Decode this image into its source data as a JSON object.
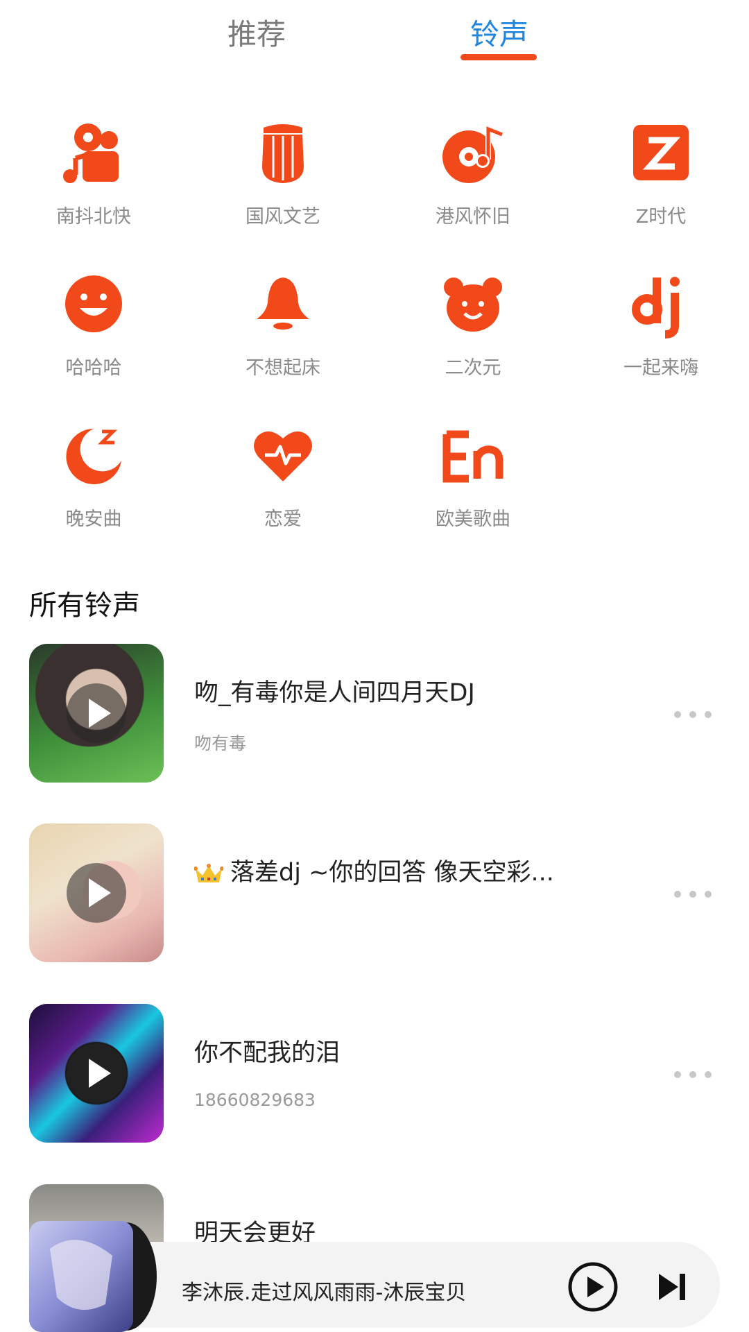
{
  "tabs": [
    {
      "label": "推荐",
      "active": false
    },
    {
      "label": "铃声",
      "active": true
    }
  ],
  "accent_color": "#f2491a",
  "active_tab_color": "#1f86e0",
  "categories": [
    {
      "label": "南抖北快",
      "icon": "camera-music-icon"
    },
    {
      "label": "国风文艺",
      "icon": "harp-icon"
    },
    {
      "label": "港风怀旧",
      "icon": "vinyl-note-icon"
    },
    {
      "label": "Z时代",
      "icon": "z-icon"
    },
    {
      "label": "哈哈哈",
      "icon": "smile-icon"
    },
    {
      "label": "不想起床",
      "icon": "bell-icon"
    },
    {
      "label": "二次元",
      "icon": "bear-icon"
    },
    {
      "label": "一起来嗨",
      "icon": "dj-icon"
    },
    {
      "label": "晚安曲",
      "icon": "moon-icon"
    },
    {
      "label": "恋爱",
      "icon": "heart-pulse-icon"
    },
    {
      "label": "欧美歌曲",
      "icon": "en-icon"
    }
  ],
  "section_title": "所有铃声",
  "songs": [
    {
      "title": "吻_有毒你是人间四月天DJ",
      "subtitle": "吻有毒",
      "crown": false
    },
    {
      "title": "落差dj ~你的回答 像天空彩...",
      "subtitle": "",
      "crown": true
    },
    {
      "title": "你不配我的泪",
      "subtitle": "18660829683",
      "crown": false
    },
    {
      "title": "明天会更好",
      "subtitle": "",
      "crown": false
    }
  ],
  "player": {
    "title": "李沐辰.走过风风雨雨-沐辰宝贝"
  }
}
